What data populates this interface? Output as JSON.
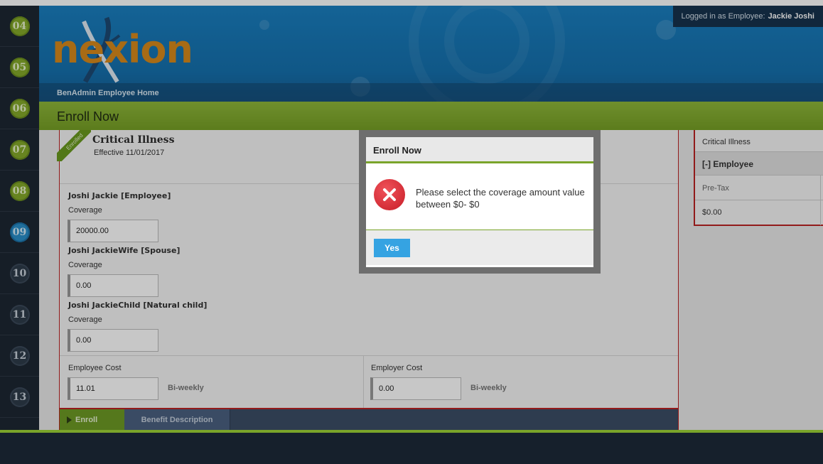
{
  "steps": [
    {
      "label": "04",
      "state": "done"
    },
    {
      "label": "05",
      "state": "done"
    },
    {
      "label": "06",
      "state": "done"
    },
    {
      "label": "07",
      "state": "done"
    },
    {
      "label": "08",
      "state": "done"
    },
    {
      "label": "09",
      "state": "current"
    },
    {
      "label": "10",
      "state": "todo"
    },
    {
      "label": "11",
      "state": "todo"
    },
    {
      "label": "12",
      "state": "todo"
    },
    {
      "label": "13",
      "state": "todo"
    }
  ],
  "header": {
    "logo_text": "nexion",
    "home_label": "BenAdmin Employee Home",
    "login_prefix": "Logged in as Employee:",
    "login_name": "Jackie Joshi"
  },
  "page": {
    "title": "Enroll Now"
  },
  "plan": {
    "ribbon": "Enrolled",
    "name": "Critical Illness",
    "effective": "Effective 11/01/2017",
    "coverage_label": "Coverage",
    "members": [
      {
        "name": "Joshi Jackie [Employee]",
        "coverage": "20000.00"
      },
      {
        "name": "Joshi JackieWife [Spouse]",
        "coverage": "0.00"
      },
      {
        "name": "Joshi JackieChild [Natural child]",
        "coverage": "0.00"
      }
    ],
    "employee_cost_label": "Employee Cost",
    "employee_cost": "11.01",
    "employer_cost_label": "Employer Cost",
    "employer_cost": "0.00",
    "frequency": "Bi-weekly"
  },
  "tabs": {
    "enroll": "Enroll",
    "benefit": "Benefit Description"
  },
  "summary": {
    "plan": "Critical Illness",
    "section": "[-] Employee",
    "tax_label": "Pre-Tax",
    "amount": "$0.00"
  },
  "modal": {
    "title": "Enroll Now",
    "message": "Please select the coverage amount value between $0- $0",
    "yes_label": "Yes"
  },
  "colors": {
    "accent_green": "#7aa42a",
    "banner_blue": "#1a7fc0",
    "error_red": "#d32630",
    "button_blue": "#35a3e2"
  }
}
